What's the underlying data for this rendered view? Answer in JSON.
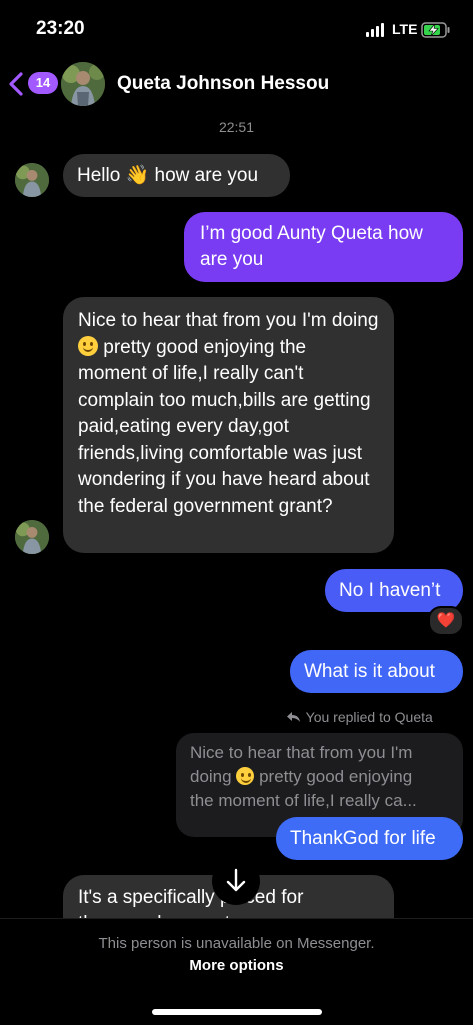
{
  "status_bar": {
    "time": "23:20",
    "carrier": "LTE",
    "battery_icon": "battery-charging-icon"
  },
  "header": {
    "unread_count": "14",
    "contact_name": "Queta Johnson Hessou"
  },
  "conversation": {
    "timestamp": "22:51",
    "messages": [
      {
        "direction": "incoming",
        "text_before": "Hello",
        "emoji": "👋",
        "text_after": "how are you"
      },
      {
        "direction": "outgoing",
        "text": "I’m good Aunty Queta how are you",
        "color": "#7a3cf2"
      },
      {
        "direction": "incoming",
        "line1_before": "Nice to hear that from you I'm",
        "line2_before": "doing",
        "line2_after": "pretty good enjoying",
        "rest": "the moment of life,I really can't complain too much,bills are getting paid,eating every day,got friends,living comfortable was just wondering if you have heard about the federal government grant?"
      },
      {
        "direction": "outgoing",
        "text": "No I haven’t",
        "color": "#4a5cf6",
        "reaction": "❤️"
      },
      {
        "direction": "outgoing",
        "text": "What is it about",
        "color": "#4167f7"
      },
      {
        "direction": "outgoing",
        "reply_label": "You replied to Queta",
        "quoted_line1": "Nice to hear that from you I'm",
        "quoted_line2_before": "doing",
        "quoted_line2_after": "pretty good enjoying",
        "quoted_line3": "the moment of life,I really ca...",
        "text": "ThankGod for life",
        "color": "#3e6cf7"
      },
      {
        "direction": "incoming",
        "text_line1": "It's a specifically placed for",
        "text_line2": "the ... ...ple ... ...nt..."
      }
    ]
  },
  "footer": {
    "unavailable_text": "This person is unavailable on Messenger.",
    "more_options": "More options"
  },
  "colors": {
    "accent_badge": "#a259ff",
    "incoming_bubble": "#303030"
  }
}
